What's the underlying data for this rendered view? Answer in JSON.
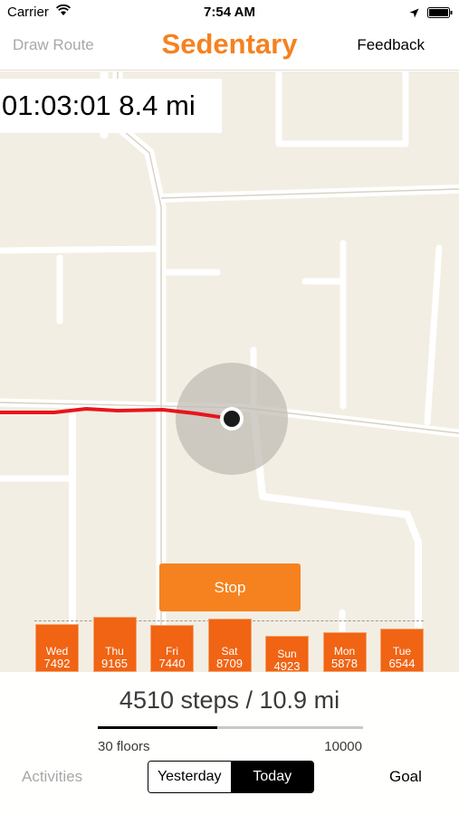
{
  "status_bar": {
    "carrier": "Carrier",
    "time": "7:54 AM"
  },
  "nav": {
    "left": "Draw Route",
    "title": "Sedentary",
    "right": "Feedback"
  },
  "map": {
    "timer": "01:03:01 8.4 mi",
    "stop_label": "Stop",
    "route_color": "#e8141c",
    "accent_color": "#f5821f"
  },
  "chart_data": {
    "type": "bar",
    "categories": [
      "Wed",
      "Thu",
      "Fri",
      "Sat",
      "Sun",
      "Mon",
      "Tue"
    ],
    "values": [
      7492,
      9165,
      7440,
      8709,
      4923,
      5878,
      6544
    ],
    "goal": 10000,
    "ylim": [
      0,
      10000
    ]
  },
  "summary": {
    "text": "4510 steps / 10.9 mi",
    "progress": 0.45,
    "floors": "30 floors",
    "goal": "10000"
  },
  "bottom_nav": {
    "activities": "Activities",
    "yesterday": "Yesterday",
    "today": "Today",
    "goal": "Goal"
  }
}
